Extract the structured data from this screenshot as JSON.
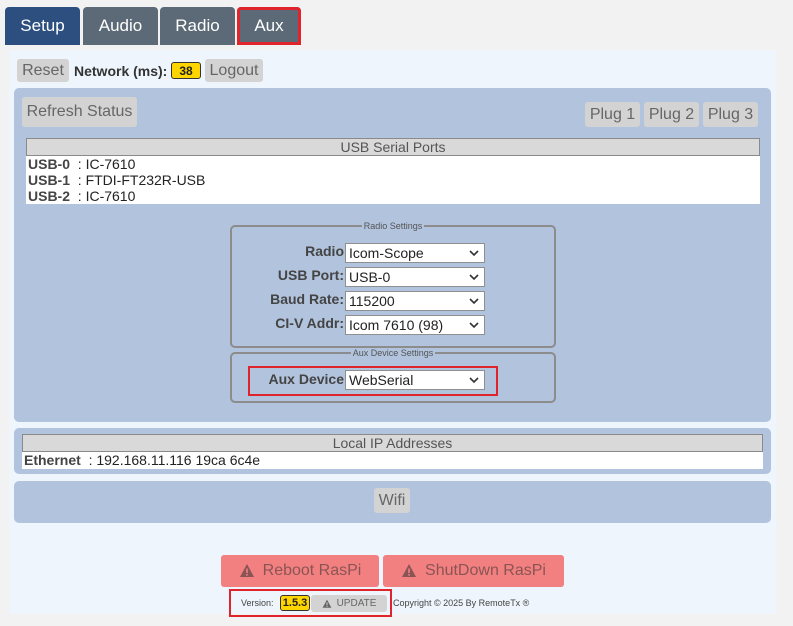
{
  "tabs": [
    {
      "label": "Setup"
    },
    {
      "label": "Audio"
    },
    {
      "label": "Radio"
    },
    {
      "label": "Aux"
    }
  ],
  "toolbar": {
    "reset_label": "Reset",
    "network_label": "Network (ms):",
    "network_value": "38",
    "logout_label": "Logout"
  },
  "status": {
    "refresh_label": "Refresh Status",
    "plugs": [
      "Plug 1",
      "Plug 2",
      "Plug 3"
    ],
    "usb_header": "USB Serial Ports",
    "usb_ports": [
      {
        "name": "USB-0",
        "device": ": IC-7610"
      },
      {
        "name": "USB-1",
        "device": ": FTDI-FT232R-USB"
      },
      {
        "name": "USB-2",
        "device": ": IC-7610"
      }
    ]
  },
  "radio_settings": {
    "legend": "Radio Settings",
    "fields": [
      {
        "label": "Radio",
        "value": "Icom-Scope"
      },
      {
        "label": "USB Port:",
        "value": "USB-0"
      },
      {
        "label": "Baud Rate:",
        "value": "115200"
      },
      {
        "label": "CI-V Addr:",
        "value": "Icom 7610 (98)"
      }
    ]
  },
  "aux_settings": {
    "legend": "Aux Device Settings",
    "label": "Aux Device",
    "value": "WebSerial"
  },
  "network": {
    "header": "Local IP Addresses",
    "iface": "Ethernet",
    "value": ": 192.168.11.116 19ca 6c4e"
  },
  "wifi_label": "Wifi",
  "actions": {
    "reboot_label": "Reboot RasPi",
    "shutdown_label": "ShutDown RasPi"
  },
  "footer": {
    "version_label": "Version:",
    "version_value": "1.5.3",
    "update_label": "UPDATE",
    "copyright": "Copyright © 2025 By RemoteTx ®"
  },
  "colors": {
    "tab_active": "#2d4f80",
    "tab": "#5b6a76",
    "highlight": "#e0242c",
    "section_bg": "#b1c3dd",
    "danger_button": "#f28080",
    "badge": "#ffd500"
  }
}
